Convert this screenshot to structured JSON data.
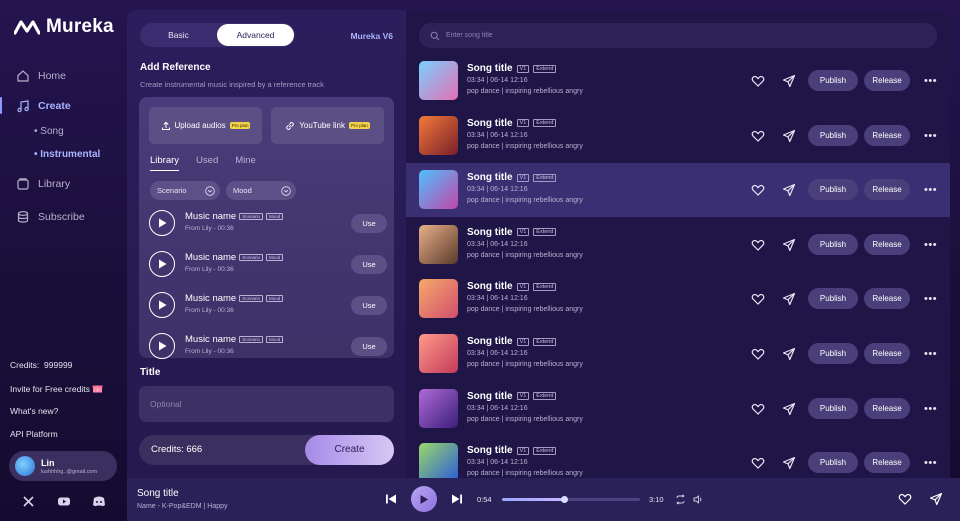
{
  "app": {
    "name": "Mureka"
  },
  "sidebar": {
    "nav": [
      {
        "label": "Home",
        "icon": "home-icon"
      },
      {
        "label": "Create",
        "icon": "music-note-icon",
        "active": true
      },
      {
        "label": "Library",
        "icon": "library-icon"
      },
      {
        "label": "Subscribe",
        "icon": "stack-icon"
      }
    ],
    "create_sub": [
      {
        "label": "• Song"
      },
      {
        "label": "• Instrumental",
        "active": true
      }
    ],
    "credits_label": "Credits:",
    "credits_value": "999999",
    "invite": "Invite for Free credits",
    "whats_new": "What's new?",
    "api": "API Platform",
    "user": {
      "name": "Lin",
      "email": "lushhhhg..@gmail.com"
    },
    "socials": [
      "x-icon",
      "youtube-icon",
      "discord-icon"
    ]
  },
  "panel": {
    "modes": [
      "Basic",
      "Advanced"
    ],
    "selected_mode": "Advanced",
    "version": "Mureka V6",
    "add_reference_title": "Add Reference",
    "add_reference_desc": "Create instrumental music inspired by a reference track",
    "upload_audios": "Upload audios",
    "youtube_link": "YouTube link",
    "pro_badge": "Pro plan",
    "tabs": [
      "Library",
      "Used",
      "Mine"
    ],
    "selected_tab": "Library",
    "filters": [
      "Scenario",
      "Mood"
    ],
    "music": [
      {
        "name": "Music name",
        "tags": [
          "Scenario",
          "Mood"
        ],
        "from": "From Lily - 00:36",
        "action": "Use"
      },
      {
        "name": "Music name",
        "tags": [
          "Scenario",
          "Mood"
        ],
        "from": "From Lily - 00:36",
        "action": "Use"
      },
      {
        "name": "Music name",
        "tags": [
          "Scenario",
          "Mood"
        ],
        "from": "From Lily - 00:36",
        "action": "Use"
      },
      {
        "name": "Music name",
        "tags": [
          "Scenario",
          "Mood"
        ],
        "from": "From Lily - 00:36",
        "action": "Use"
      }
    ],
    "title_label": "Title",
    "title_placeholder": "Optional",
    "credits": "Credits: 666",
    "create_label": "Create"
  },
  "search": {
    "placeholder": "Enter song title"
  },
  "songs": [
    {
      "title": "Song title",
      "version": "V1",
      "extend": "Extend",
      "meta": "03:34  |  06-14 12:16",
      "genre": "pop dance  |  inspiring rebellious angry",
      "publish": "Publish",
      "release": "Release",
      "colors": [
        "#7ad0ff",
        "#e46fb4"
      ]
    },
    {
      "title": "Song title",
      "version": "V1",
      "extend": "Extend",
      "meta": "03:34  |  06-14 12:16",
      "genre": "pop dance  |  inspiring rebellious angry",
      "publish": "Publish",
      "release": "Release",
      "colors": [
        "#f27a3a",
        "#7a1f2a"
      ]
    },
    {
      "title": "Song title",
      "version": "V1",
      "extend": "Extend",
      "meta": "03:34  |  06-14 12:16",
      "genre": "pop dance  |  inspiring rebellious angry",
      "publish": "Publish",
      "release": "Release",
      "colors": [
        "#4fc0ff",
        "#c246a8"
      ],
      "highlighted": true
    },
    {
      "title": "Song title",
      "version": "V1",
      "extend": "Extend",
      "meta": "03:34  |  06-14 12:16",
      "genre": "pop dance  |  inspiring rebellious angry",
      "publish": "Publish",
      "release": "Release",
      "colors": [
        "#e8b08a",
        "#5a3a2a"
      ]
    },
    {
      "title": "Song title",
      "version": "V1",
      "extend": "Extend",
      "meta": "03:34  |  06-14 12:16",
      "genre": "pop dance  |  inspiring rebellious angry",
      "publish": "Publish",
      "release": "Release",
      "colors": [
        "#f5a86a",
        "#d2506e"
      ]
    },
    {
      "title": "Song title",
      "version": "V1",
      "extend": "Extend",
      "meta": "03:34  |  06-14 12:16",
      "genre": "pop dance  |  inspiring rebellious angry",
      "publish": "Publish",
      "release": "Release",
      "colors": [
        "#ff9a8a",
        "#c23a5a"
      ]
    },
    {
      "title": "Song title",
      "version": "V1",
      "extend": "Extend",
      "meta": "03:34  |  06-14 12:16",
      "genre": "pop dance  |  inspiring rebellious angry",
      "publish": "Publish",
      "release": "Release",
      "colors": [
        "#b06ad8",
        "#3a1f7a"
      ]
    },
    {
      "title": "Song title",
      "version": "V1",
      "extend": "Extend",
      "meta": "03:34  |  06-14 12:16",
      "genre": "pop dance  |  inspiring rebellious angry",
      "publish": "Publish",
      "release": "Release",
      "colors": [
        "#9ad86a",
        "#2a5ad8"
      ]
    }
  ],
  "player": {
    "title": "Song title",
    "subtitle": "Name - K-Pop&EDM | Happy",
    "current_time": "0:54",
    "total_time": "3:10",
    "progress": 0.45
  },
  "colors": {
    "accent": "#a8b4ff",
    "background": "#1a0f3a",
    "highlight": "#3b2f73"
  }
}
